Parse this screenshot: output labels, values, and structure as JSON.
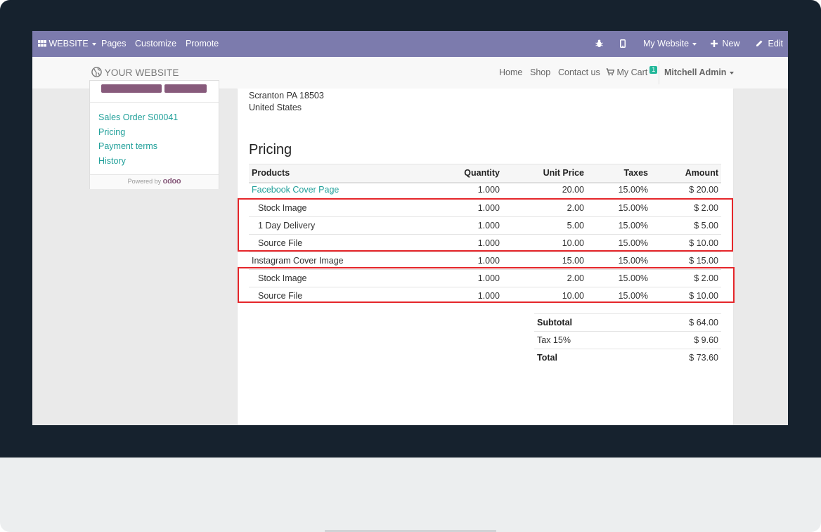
{
  "admin_bar": {
    "apps_label": "WEBSITE",
    "menu": [
      "Pages",
      "Customize",
      "Promote"
    ],
    "website_selector": "My Website",
    "new_label": "New",
    "edit_label": "Edit"
  },
  "site_header": {
    "logo_text": "YOUR WEBSITE",
    "nav": [
      "Home",
      "Shop",
      "Contact us"
    ],
    "cart_label": "My Cart",
    "cart_count": "1",
    "user_name": "Mitchell Admin"
  },
  "sidebar": {
    "links": [
      "Sales Order S00041",
      "Pricing",
      "Payment terms",
      "History"
    ],
    "powered_by": "Powered by",
    "brand": "odoo"
  },
  "document": {
    "address_lines": [
      "Scranton PA 18503",
      "United States"
    ],
    "section_title": "Pricing",
    "table": {
      "headers": [
        "Products",
        "Quantity",
        "Unit Price",
        "Taxes",
        "Amount"
      ],
      "rows": [
        {
          "name": "Facebook Cover Page",
          "qty": "1.000",
          "price": "20.00",
          "tax": "15.00%",
          "amount": "$ 20.00"
        },
        {
          "name": "Stock Image",
          "qty": "1.000",
          "price": "2.00",
          "tax": "15.00%",
          "amount": "$ 2.00"
        },
        {
          "name": "1 Day Delivery",
          "qty": "1.000",
          "price": "5.00",
          "tax": "15.00%",
          "amount": "$ 5.00"
        },
        {
          "name": "Source File",
          "qty": "1.000",
          "price": "10.00",
          "tax": "15.00%",
          "amount": "$ 10.00"
        },
        {
          "name": "Instagram Cover Image",
          "qty": "1.000",
          "price": "15.00",
          "tax": "15.00%",
          "amount": "$ 15.00"
        },
        {
          "name": "Stock Image",
          "qty": "1.000",
          "price": "2.00",
          "tax": "15.00%",
          "amount": "$ 2.00"
        },
        {
          "name": "Source File",
          "qty": "1.000",
          "price": "10.00",
          "tax": "15.00%",
          "amount": "$ 10.00"
        }
      ]
    },
    "totals": [
      {
        "label": "Subtotal",
        "value": "$ 64.00"
      },
      {
        "label": "Tax 15%",
        "value": "$ 9.60"
      },
      {
        "label": "Total",
        "value": "$ 73.60"
      }
    ]
  },
  "colors": {
    "admin_bar": "#7c7bad",
    "link": "#21a09a",
    "highlight": "#e5262a",
    "bezel": "#16222e",
    "brand_button": "#875a7b"
  }
}
